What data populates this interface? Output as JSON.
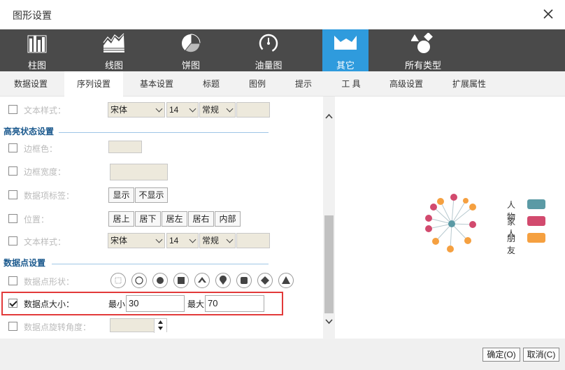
{
  "window": {
    "title": "图形设置"
  },
  "chart_types": [
    {
      "label": "柱图",
      "icon": "bar-chart-icon"
    },
    {
      "label": "线图",
      "icon": "line-chart-icon"
    },
    {
      "label": "饼图",
      "icon": "pie-chart-icon"
    },
    {
      "label": "油量图",
      "icon": "gauge-icon"
    },
    {
      "label": "其它",
      "icon": "other-chart-icon",
      "active": true
    },
    {
      "label": "所有类型",
      "icon": "all-types-icon"
    }
  ],
  "tabs": [
    {
      "label": "数据设置"
    },
    {
      "label": "序列设置",
      "active": true
    },
    {
      "label": "基本设置"
    },
    {
      "label": "标题"
    },
    {
      "label": "图例"
    },
    {
      "label": "提示"
    },
    {
      "label": "工 具"
    },
    {
      "label": "高级设置"
    },
    {
      "label": "扩展属性"
    }
  ],
  "settings": {
    "text_style_top": {
      "label": "文本样式：",
      "font": "宋体",
      "size": "14",
      "weight": "常规"
    },
    "highlight_section": "高亮状态设置",
    "border_color": {
      "label": "边框色："
    },
    "border_width": {
      "label": "边框宽度："
    },
    "data_label": {
      "label": "数据项标签：",
      "show": "显示",
      "hide": "不显示"
    },
    "position": {
      "label": "位置：",
      "options": [
        "居上",
        "居下",
        "居左",
        "居右",
        "内部"
      ]
    },
    "text_style_bottom": {
      "label": "文本样式：",
      "font": "宋体",
      "size": "14",
      "weight": "常规"
    },
    "datapoint_section": "数据点设置",
    "point_shape": {
      "label": "数据点形状："
    },
    "point_size": {
      "label": "数据点大小：",
      "min_label": "最小",
      "min_value": "30",
      "max_label": "最大",
      "max_value": "70",
      "checked": true
    },
    "point_rotation": {
      "label": "数据点旋转角度："
    }
  },
  "preview": {
    "legend": [
      {
        "name": "人物",
        "color": "#5b9aa5"
      },
      {
        "name": "家人",
        "color": "#d24a6e"
      },
      {
        "name": "朋友",
        "color": "#f5a040"
      }
    ]
  },
  "footer": {
    "ok": "确定(O)",
    "cancel": "取消(C)"
  }
}
